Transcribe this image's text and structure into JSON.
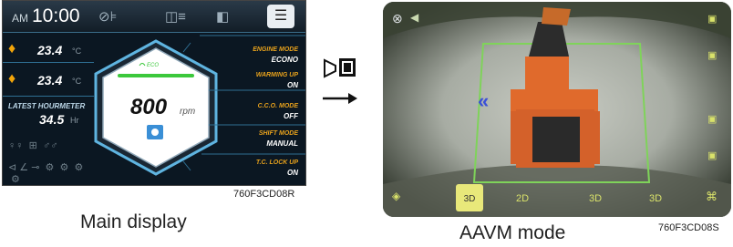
{
  "main_display": {
    "ampm": "AM",
    "time": "10:00",
    "temps": [
      {
        "value": "23.4",
        "unit": "°C"
      },
      {
        "value": "23.4",
        "unit": "°C"
      }
    ],
    "hourmeter_label": "LATEST HOURMETER",
    "hourmeter_value": "34.5",
    "hourmeter_unit": "Hr",
    "eco_label": "ECO",
    "rpm_value": "800",
    "rpm_unit": "rpm",
    "modes": [
      {
        "label": "ENGINE MODE",
        "value": "ECONO"
      },
      {
        "label": "WARMING UP",
        "value": "ON"
      },
      {
        "label": "C.C.O. MODE",
        "value": "OFF"
      },
      {
        "label": "SHIFT MODE",
        "value": "MANUAL"
      },
      {
        "label": "T.C. LOCK UP",
        "value": "ON"
      }
    ],
    "image_code": "760F3CD08R",
    "caption": "Main display"
  },
  "aavm": {
    "view_buttons": [
      "3D",
      "2D",
      "3D",
      "3D"
    ],
    "image_code": "760F3CD08S",
    "caption": "AAVM mode"
  },
  "colors": {
    "accent_orange": "#e8a21c",
    "eco_green": "#3cc83c",
    "frame_green": "#7fd35a"
  }
}
